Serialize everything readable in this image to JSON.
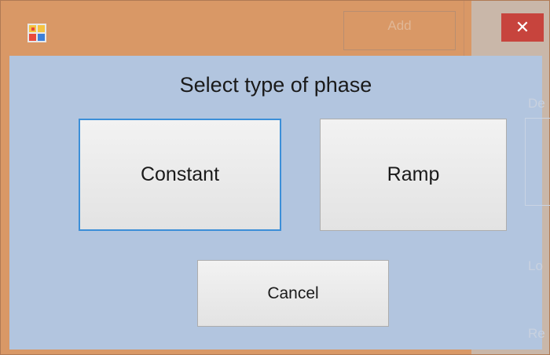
{
  "background_window": {
    "add_label": "Add",
    "labels": [
      "De",
      "Lo",
      "Re"
    ]
  },
  "dialog": {
    "close_glyph": "✕",
    "prompt": "Select type of phase",
    "buttons": {
      "constant": "Constant",
      "ramp": "Ramp",
      "cancel": "Cancel"
    }
  },
  "colors": {
    "frame": "#d99866",
    "client": "#b2c5df",
    "close": "#c7443d",
    "focus_border": "#3c8fd8"
  },
  "icons": {
    "app_icon": "app-icon",
    "close_icon": "close-icon"
  }
}
